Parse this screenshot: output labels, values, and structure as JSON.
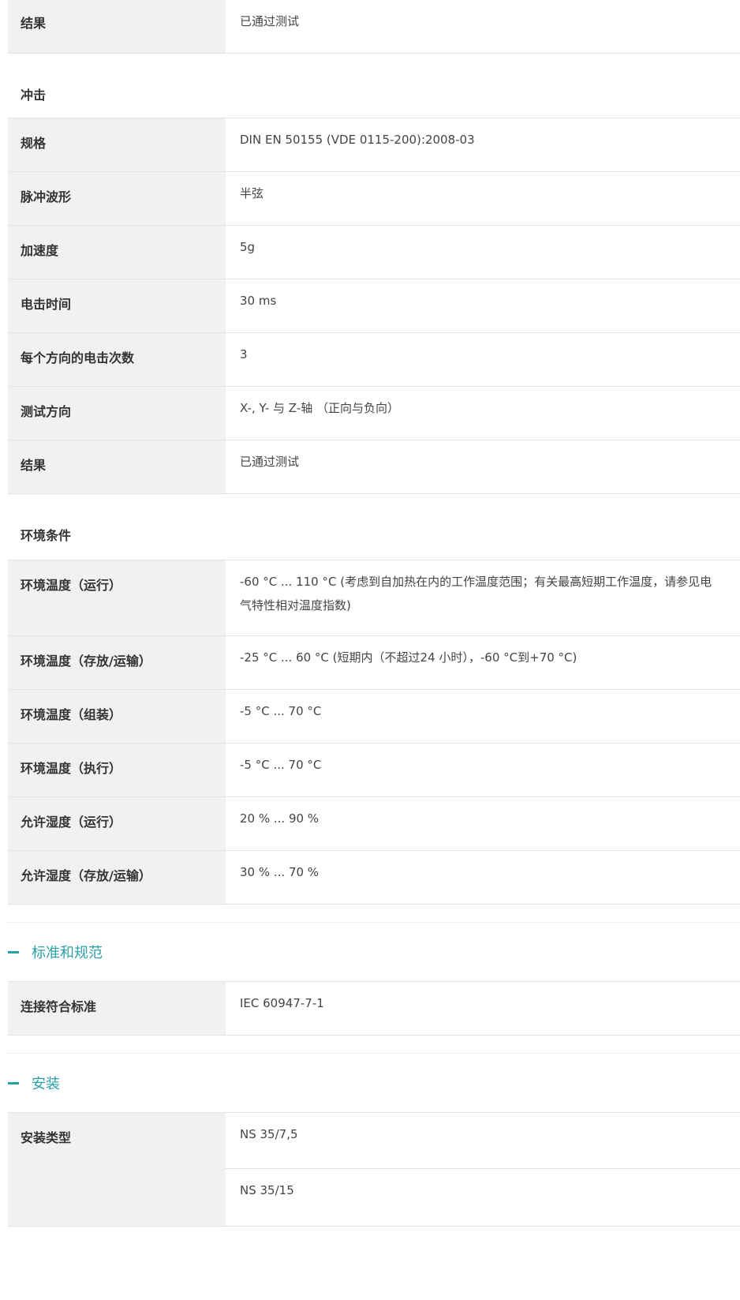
{
  "vibration": {
    "rows": [
      {
        "label": "结果",
        "value": "已通过测试"
      }
    ]
  },
  "shock": {
    "title": "冲击",
    "rows": [
      {
        "label": "规格",
        "value": "DIN EN 50155 (VDE 0115-200):2008-03"
      },
      {
        "label": "脉冲波形",
        "value": "半弦"
      },
      {
        "label": "加速度",
        "value": "5g"
      },
      {
        "label": "电击时间",
        "value": "30 ms"
      },
      {
        "label": "每个方向的电击次数",
        "value": "3"
      },
      {
        "label": "测试方向",
        "value": "X-, Y- 与 Z-轴 （正向与负向）"
      },
      {
        "label": "结果",
        "value": "已通过测试"
      }
    ]
  },
  "environment": {
    "title": "环境条件",
    "rows": [
      {
        "label": "环境温度（运行）",
        "value": "-60 °C ... 110 °C (考虑到自加热在内的工作温度范围；有关最高短期工作温度，请参见电气特性相对温度指数)"
      },
      {
        "label": "环境温度（存放/运输）",
        "value": "-25 °C ... 60 °C (短期内（不超过24 小时），-60 °C到+70 °C)"
      },
      {
        "label": "环境温度（组装）",
        "value": "-5 °C ... 70 °C"
      },
      {
        "label": "环境温度（执行）",
        "value": "-5 °C ... 70 °C"
      },
      {
        "label": "允许湿度（运行）",
        "value": "20 % ... 90 %"
      },
      {
        "label": "允许湿度（存放/运输）",
        "value": "30 % ... 70 %"
      }
    ]
  },
  "standards": {
    "title": "标准和规范",
    "rows": [
      {
        "label": "连接符合标准",
        "value": "IEC 60947-7-1"
      }
    ]
  },
  "mounting": {
    "title": "安装",
    "label": "安装类型",
    "values": [
      "NS 35/7,5",
      "NS 35/15"
    ]
  },
  "colors": {
    "accent": "#2aa0a8",
    "label_bg": "#f1f1f1",
    "border": "#e3e3e3"
  },
  "icons": {
    "section_toggle": "minus-icon"
  }
}
